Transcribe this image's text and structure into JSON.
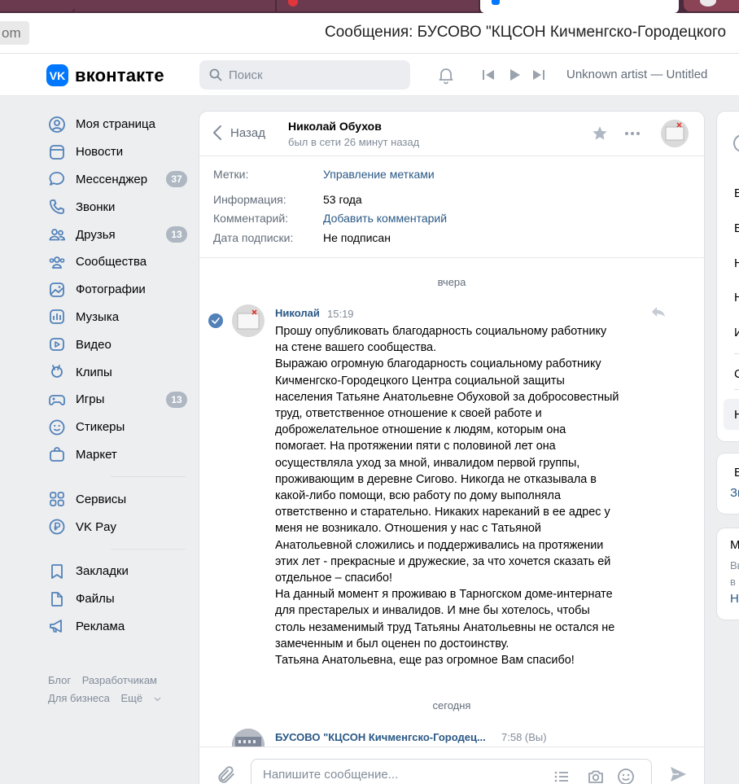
{
  "browser": {
    "tab_partial_url": "om",
    "page_title": "Сообщения: БУСОВО \"КЦСОН Кичменгско-Городецкого"
  },
  "header": {
    "logo_text": "вконтакте",
    "logo_mark": "VK",
    "search_placeholder": "Поиск",
    "track": "Unknown artist — Untitled",
    "accent_color": "#0077ff"
  },
  "sidebar": {
    "items": [
      {
        "label": "Моя страница",
        "icon": "user-circle-icon"
      },
      {
        "label": "Новости",
        "icon": "newspaper-icon"
      },
      {
        "label": "Мессенджер",
        "icon": "message-icon",
        "badge": "37"
      },
      {
        "label": "Звонки",
        "icon": "phone-icon"
      },
      {
        "label": "Друзья",
        "icon": "friends-icon",
        "badge": "13"
      },
      {
        "label": "Сообщества",
        "icon": "communities-icon"
      },
      {
        "label": "Фотографии",
        "icon": "photo-icon"
      },
      {
        "label": "Музыка",
        "icon": "music-icon"
      },
      {
        "label": "Видео",
        "icon": "video-icon"
      },
      {
        "label": "Клипы",
        "icon": "clips-icon"
      },
      {
        "label": "Игры",
        "icon": "gamepad-icon",
        "badge": "13"
      },
      {
        "label": "Стикеры",
        "icon": "smile-icon"
      },
      {
        "label": "Маркет",
        "icon": "bag-icon"
      }
    ],
    "items2": [
      {
        "label": "Сервисы",
        "icon": "grid-icon"
      },
      {
        "label": "VK Pay",
        "icon": "vkpay-icon"
      }
    ],
    "items3": [
      {
        "label": "Закладки",
        "icon": "bookmark-icon"
      },
      {
        "label": "Файлы",
        "icon": "file-icon"
      },
      {
        "label": "Реклама",
        "icon": "megaphone-icon"
      }
    ],
    "footer": {
      "blog": "Блог",
      "developers": "Разработчикам",
      "business": "Для бизнеса",
      "more": "Ещё"
    }
  },
  "chat": {
    "back_label": "Назад",
    "peer_name": "Николай Обухов",
    "peer_status": "был в сети 26 минут назад",
    "info": {
      "tags_key": "Метки:",
      "tags_value": "Управление метками",
      "info_key": "Информация:",
      "info_value": "53 года",
      "comment_key": "Комментарий:",
      "comment_value": "Добавить комментарий",
      "sub_key": "Дата подписки:",
      "sub_value": "Не подписан"
    },
    "date_yesterday": "вчера",
    "message": {
      "author": "Николай",
      "time": "15:19",
      "text": "Прошу опубликовать благодарность социальному работнику\nна стене вашего сообщества.\nВыражаю огромную благодарность социальному работнику\nКичменгско-Городецкого Центра социальной защиты\nнаселения Татьяне Анатольевне Обуховой за добросовестный\nтруд, ответственное отношение к своей работе и\nдоброжелательное отношение к людям, которым она\nпомогает. На протяжении пяти с половиной лет она\nосуществляла уход за мной, инвалидом первой группы,\nпроживающим в деревне Сигово. Никогда не отказывала в\nкакой-либо помощи, всю работу по дому выполняла\nответственно и старательно. Никаких нареканий в ее адрес у\nменя не возникало. Отношения у нас с Татьяной\nАнатольевной сложились и поддерживались на протяжении\nэтих лет - прекрасные и дружеские, за что хочется сказать ей\nотдельное – спасибо!\nНа данный момент я проживаю в Тарногском доме-интернате\nдля престарелых и инвалидов. И мне бы хотелось, чтобы\nстоль незаменимый труд Татьяны Анатольевны не остался не\nзамеченным и был оценен по достоинству.\nТатьяна Анатольевна, еще раз огромное Вам спасибо!"
    },
    "date_today": "сегодня",
    "message2": {
      "author": "БУСОВО \"КЦСОН Кичменгско-Городец...",
      "time": "7:58 (Вы)"
    },
    "composer_placeholder": "Напишите сообщение..."
  },
  "right": {
    "card1_letters": [
      "В",
      "В",
      "Н",
      "Н",
      "И",
      "С",
      "Н"
    ],
    "card2_line1": "Вр",
    "card2_line2": "Зн",
    "card3_line1": "М",
    "card3_line2": "Вы",
    "card3_line3": "в",
    "card3_line4": "На"
  }
}
